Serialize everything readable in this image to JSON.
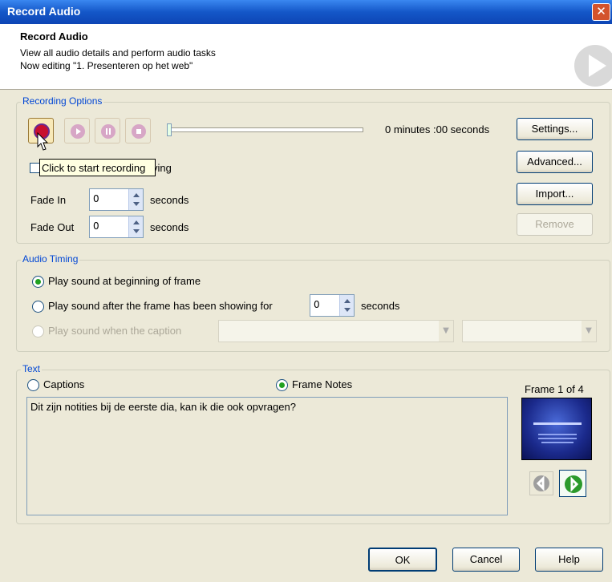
{
  "window": {
    "title": "Record Audio",
    "close_icon": "close-icon"
  },
  "header": {
    "title": "Record Audio",
    "line1": "View all audio details and perform audio tasks",
    "line2": "Now editing \"1. Presenteren op het web\""
  },
  "recording": {
    "group_label": "Recording Options",
    "time": "0 minutes :00 seconds",
    "tooltip": "Click to start recording",
    "checkbox_label_tail": "ying",
    "fade_in_label": "Fade In",
    "fade_in_value": "0",
    "fade_out_label": "Fade Out",
    "fade_out_value": "0",
    "seconds": "seconds",
    "buttons": {
      "settings": "Settings...",
      "advanced": "Advanced...",
      "import": "Import...",
      "remove": "Remove"
    }
  },
  "timing": {
    "group_label": "Audio Timing",
    "opt1": "Play sound at beginning of frame",
    "opt2": "Play sound after the frame has been showing for",
    "opt2_value": "0",
    "opt2_unit": "seconds",
    "opt3": "Play sound when the caption"
  },
  "text": {
    "group_label": "Text",
    "captions": "Captions",
    "frame_notes": "Frame Notes",
    "frame_counter": "Frame 1 of 4",
    "notes": "Dit zijn notities bij de eerste dia, kan ik die ook opvragen?"
  },
  "footer": {
    "ok": "OK",
    "cancel": "Cancel",
    "help": "Help"
  },
  "colors": {
    "accent": "#0046d5",
    "title_bar": "#1457c8",
    "record": "#c8102e"
  }
}
